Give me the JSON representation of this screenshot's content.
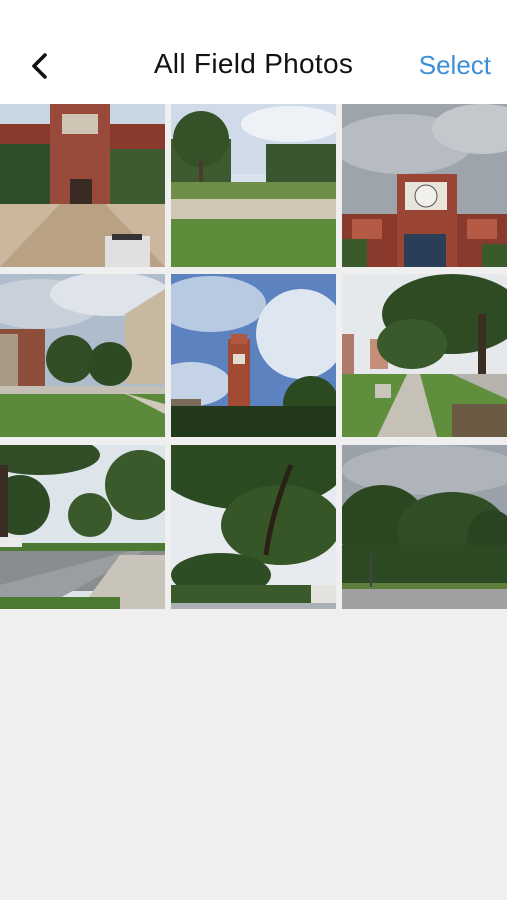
{
  "nav": {
    "back_icon": "chevron-left-icon",
    "title": "All Field Photos",
    "select_label": "Select",
    "accent_color": "#3d8fd8"
  },
  "photos": [
    {
      "subject": "brick clock tower library with plaza"
    },
    {
      "subject": "lawn with trees"
    },
    {
      "subject": "brick building with clock"
    },
    {
      "subject": "campus lawn and buildings"
    },
    {
      "subject": "clock tower with clouds"
    },
    {
      "subject": "tree-lined sidewalk"
    },
    {
      "subject": "street with trees"
    },
    {
      "subject": "tree canopy"
    },
    {
      "subject": "row of trees by road"
    }
  ]
}
